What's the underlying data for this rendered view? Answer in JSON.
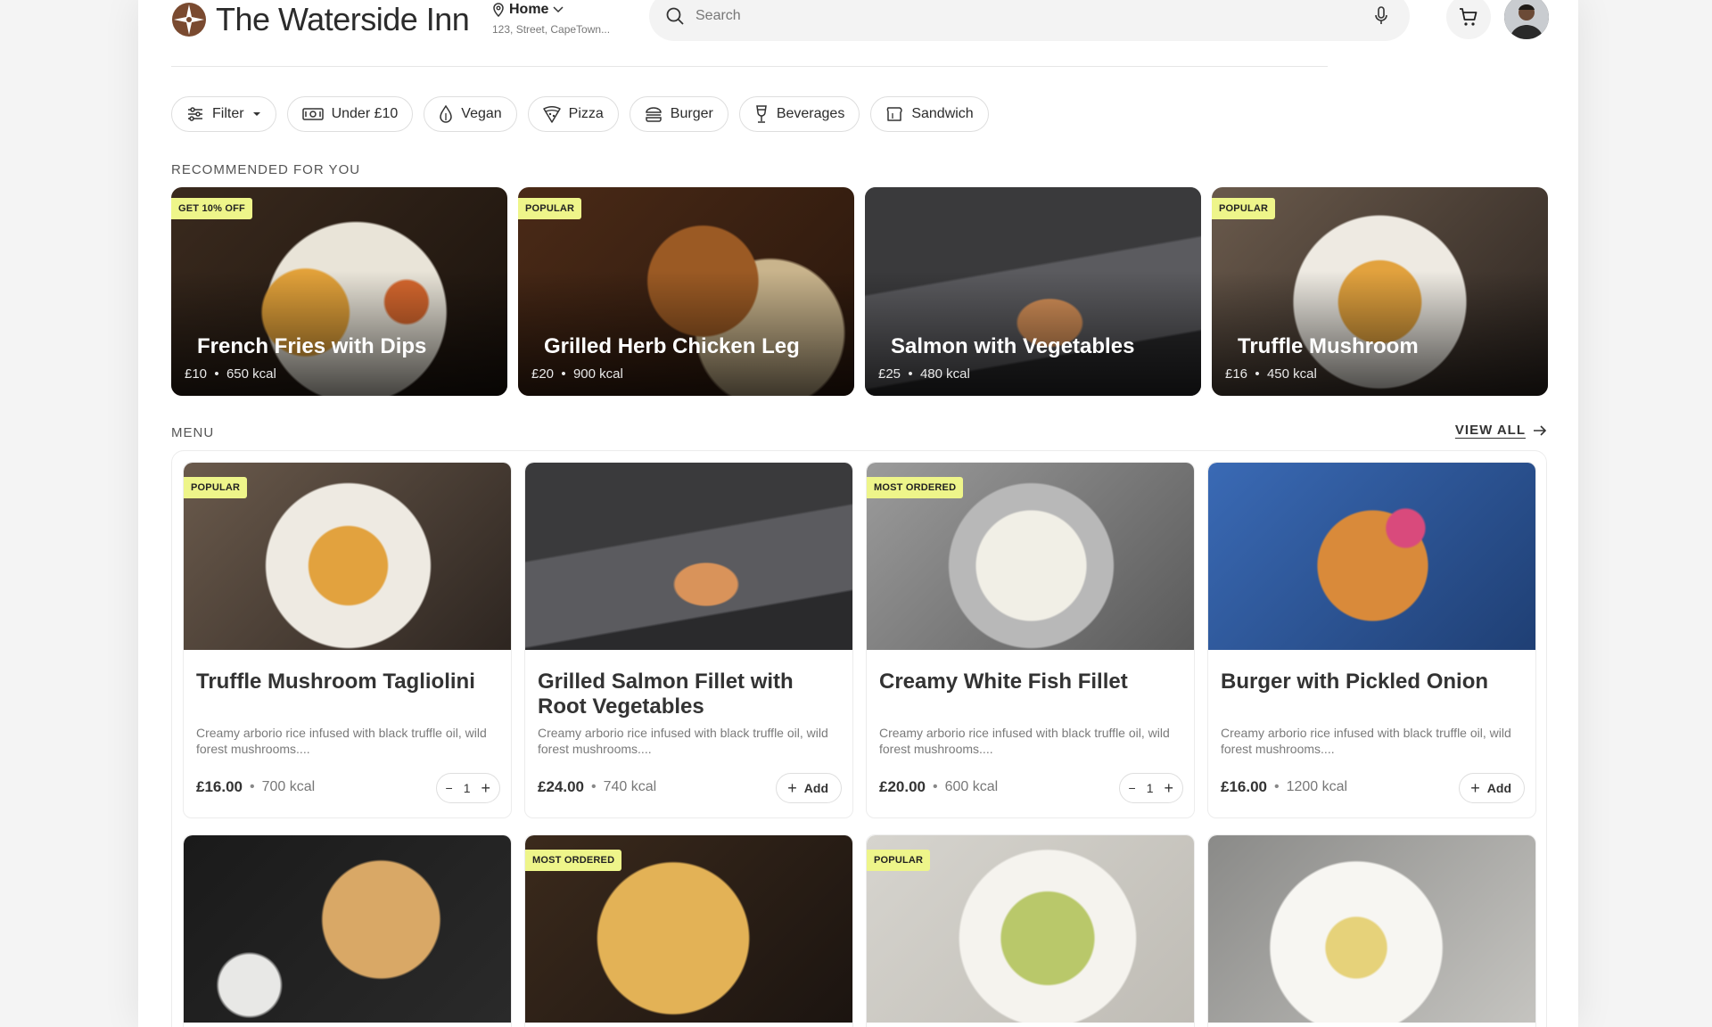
{
  "brand": {
    "name": "The Waterside Inn",
    "mark_color": "#7a4a30"
  },
  "location": {
    "label": "Home",
    "address": "123, Street, CapeTown..."
  },
  "search": {
    "placeholder": "Search"
  },
  "chips": [
    {
      "label": "Filter",
      "icon": "sliders-icon",
      "dropdown": true
    },
    {
      "label": "Under £10",
      "icon": "banknote-icon"
    },
    {
      "label": "Vegan",
      "icon": "leaf-drop-icon"
    },
    {
      "label": "Pizza",
      "icon": "pizza-icon"
    },
    {
      "label": "Burger",
      "icon": "burger-icon"
    },
    {
      "label": "Beverages",
      "icon": "wine-glass-icon"
    },
    {
      "label": "Sandwich",
      "icon": "sandwich-icon"
    }
  ],
  "recommended": {
    "label": "RECOMMENDED FOR YOU",
    "items": [
      {
        "badge": "GET 10% OFF",
        "title": "French Fries with Dips",
        "price": "£10",
        "kcal": "650 kcal"
      },
      {
        "badge": "POPULAR",
        "title": "Grilled Herb Chicken Leg",
        "price": "£20",
        "kcal": "900 kcal"
      },
      {
        "badge": "",
        "title": "Salmon with Vegetables",
        "price": "£25",
        "kcal": "480 kcal"
      },
      {
        "badge": "POPULAR",
        "title": "Truffle Mushroom",
        "price": "£16",
        "kcal": "450 kcal"
      }
    ]
  },
  "menu": {
    "label": "MENU",
    "view_all": "VIEW ALL",
    "items": [
      {
        "badge": "POPULAR",
        "title": "Truffle Mushroom Tagliolini",
        "desc": "Creamy arborio rice infused with black truffle oil, wild forest mushrooms....",
        "price": "£16.00",
        "kcal": "700 kcal",
        "qty": "1"
      },
      {
        "badge": "",
        "title": "Grilled Salmon Fillet with Root Vegetables",
        "desc": "Creamy arborio rice infused with black truffle oil, wild forest mushrooms....",
        "price": "£24.00",
        "kcal": "740 kcal",
        "add": "Add"
      },
      {
        "badge": "MOST ORDERED",
        "title": "Creamy White Fish Fillet",
        "desc": "Creamy arborio rice infused with black truffle oil, wild forest mushrooms....",
        "price": "£20.00",
        "kcal": "600 kcal",
        "qty": "1"
      },
      {
        "badge": "",
        "title": "Burger with Pickled Onion",
        "desc": "Creamy arborio rice infused with black truffle oil, wild forest mushrooms....",
        "price": "£16.00",
        "kcal": "1200 kcal",
        "add": "Add"
      },
      {
        "badge": ""
      },
      {
        "badge": "MOST ORDERED"
      },
      {
        "badge": "POPULAR"
      },
      {
        "badge": ""
      }
    ]
  },
  "colors": {
    "badge_bg": "#eef58a",
    "accent_text": "#2b2b2b"
  }
}
